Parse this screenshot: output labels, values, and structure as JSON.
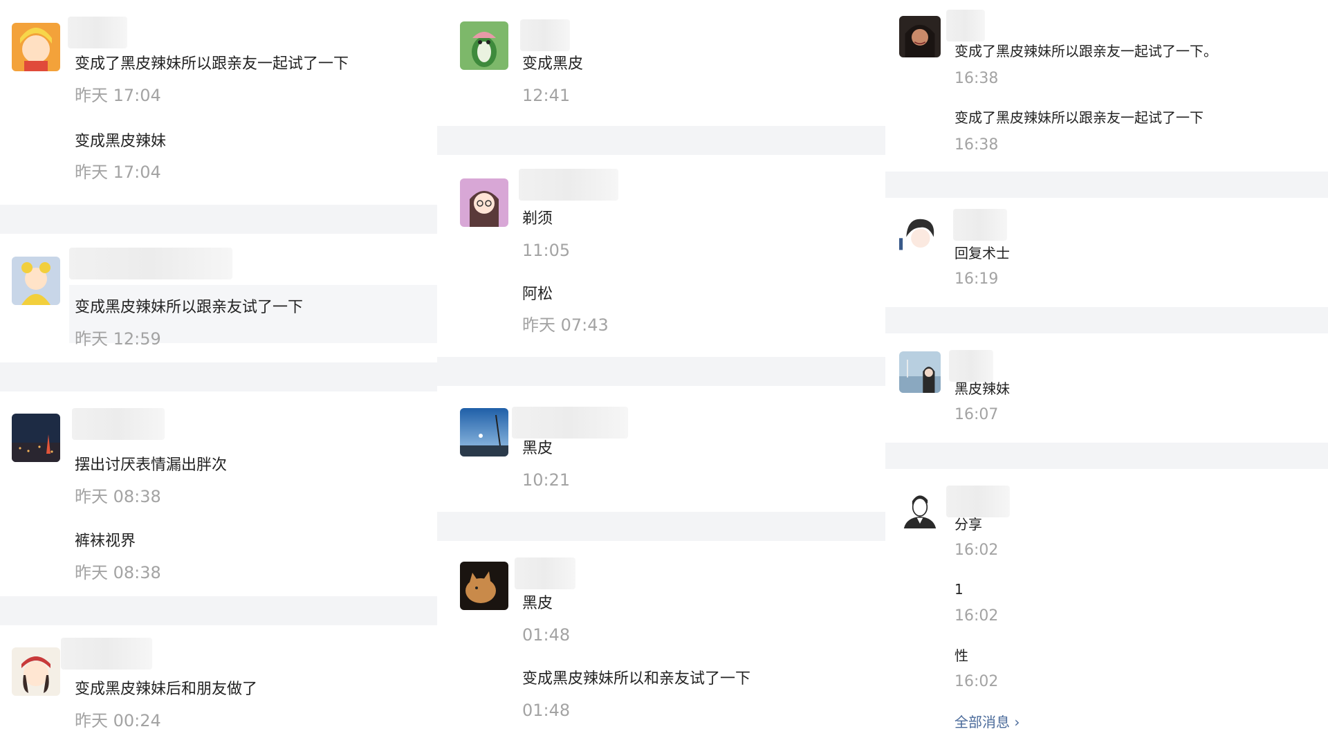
{
  "col0": {
    "c1": {
      "avatar": "cartoon-blonde-girl-avatar",
      "msg1": "变成了黑皮辣妹所以跟亲友一起试了一下",
      "time1": "昨天 17:04",
      "msg2": "变成黑皮辣妹",
      "time2": "昨天 17:04"
    },
    "c2": {
      "avatar": "yellow-costume-child-avatar",
      "msg1": "变成黑皮辣妹所以跟亲友试了一下",
      "time1": "昨天 12:59"
    },
    "c3": {
      "avatar": "city-night-tower-avatar",
      "msg1": "摆出讨厌表情漏出胖次",
      "time1": "昨天 08:38",
      "msg2": "裤袜视界",
      "time2": "昨天 08:38"
    },
    "c4": {
      "avatar": "anime-girl-cap-avatar",
      "msg1": "变成黑皮辣妹后和朋友做了",
      "time1": "昨天 00:24"
    }
  },
  "col1": {
    "c1": {
      "avatar": "penguin-pink-hat-avatar",
      "msg1": "变成黑皮",
      "time1": "12:41"
    },
    "c2": {
      "avatar": "anime-girl-glasses-avatar",
      "msg1": "剃须",
      "time1": "11:05",
      "msg2": "阿松",
      "time2": "昨天 07:43"
    },
    "c3": {
      "avatar": "blue-sky-lamp-avatar",
      "msg1": "黑皮",
      "time1": "10:21"
    },
    "c4": {
      "avatar": "cat-dark-background-avatar",
      "msg1": "黑皮",
      "time1": "01:48",
      "msg2": "变成黑皮辣妹所以和亲友试了一下",
      "time2": "01:48"
    }
  },
  "col2": {
    "c1": {
      "avatar": "woman-portrait-avatar",
      "msg1": "变成了黑皮辣妹所以跟亲友一起试了一下。",
      "time1": "16:38",
      "msg2": "变成了黑皮辣妹所以跟亲友一起试了一下",
      "time2": "16:38"
    },
    "c2": {
      "avatar": "anime-boy-sketch-avatar",
      "msg1": "回复术士",
      "time1": "16:19"
    },
    "c3": {
      "avatar": "girl-seaside-avatar",
      "msg1": "黑皮辣妹",
      "time1": "16:07"
    },
    "c4": {
      "avatar": "man-line-art-avatar",
      "msg1": "分享",
      "time1": "16:02",
      "msg2": "1",
      "time2": "16:02",
      "msg3": "性",
      "time3": "16:02",
      "all_messages": "全部消息 ›"
    }
  },
  "colors": {
    "gap": "#f3f4f6",
    "time": "#a3a3a3",
    "link": "#4a6a9a"
  }
}
